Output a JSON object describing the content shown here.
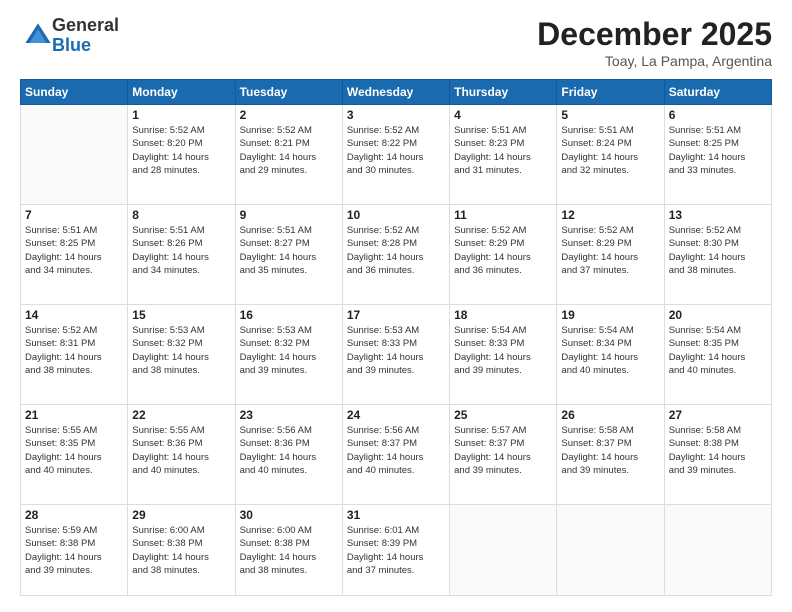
{
  "logo": {
    "general": "General",
    "blue": "Blue"
  },
  "header": {
    "title": "December 2025",
    "subtitle": "Toay, La Pampa, Argentina"
  },
  "weekdays": [
    "Sunday",
    "Monday",
    "Tuesday",
    "Wednesday",
    "Thursday",
    "Friday",
    "Saturday"
  ],
  "weeks": [
    [
      {
        "day": "",
        "info": ""
      },
      {
        "day": "1",
        "info": "Sunrise: 5:52 AM\nSunset: 8:20 PM\nDaylight: 14 hours\nand 28 minutes."
      },
      {
        "day": "2",
        "info": "Sunrise: 5:52 AM\nSunset: 8:21 PM\nDaylight: 14 hours\nand 29 minutes."
      },
      {
        "day": "3",
        "info": "Sunrise: 5:52 AM\nSunset: 8:22 PM\nDaylight: 14 hours\nand 30 minutes."
      },
      {
        "day": "4",
        "info": "Sunrise: 5:51 AM\nSunset: 8:23 PM\nDaylight: 14 hours\nand 31 minutes."
      },
      {
        "day": "5",
        "info": "Sunrise: 5:51 AM\nSunset: 8:24 PM\nDaylight: 14 hours\nand 32 minutes."
      },
      {
        "day": "6",
        "info": "Sunrise: 5:51 AM\nSunset: 8:25 PM\nDaylight: 14 hours\nand 33 minutes."
      }
    ],
    [
      {
        "day": "7",
        "info": "Sunrise: 5:51 AM\nSunset: 8:25 PM\nDaylight: 14 hours\nand 34 minutes."
      },
      {
        "day": "8",
        "info": "Sunrise: 5:51 AM\nSunset: 8:26 PM\nDaylight: 14 hours\nand 34 minutes."
      },
      {
        "day": "9",
        "info": "Sunrise: 5:51 AM\nSunset: 8:27 PM\nDaylight: 14 hours\nand 35 minutes."
      },
      {
        "day": "10",
        "info": "Sunrise: 5:52 AM\nSunset: 8:28 PM\nDaylight: 14 hours\nand 36 minutes."
      },
      {
        "day": "11",
        "info": "Sunrise: 5:52 AM\nSunset: 8:29 PM\nDaylight: 14 hours\nand 36 minutes."
      },
      {
        "day": "12",
        "info": "Sunrise: 5:52 AM\nSunset: 8:29 PM\nDaylight: 14 hours\nand 37 minutes."
      },
      {
        "day": "13",
        "info": "Sunrise: 5:52 AM\nSunset: 8:30 PM\nDaylight: 14 hours\nand 38 minutes."
      }
    ],
    [
      {
        "day": "14",
        "info": "Sunrise: 5:52 AM\nSunset: 8:31 PM\nDaylight: 14 hours\nand 38 minutes."
      },
      {
        "day": "15",
        "info": "Sunrise: 5:53 AM\nSunset: 8:32 PM\nDaylight: 14 hours\nand 38 minutes."
      },
      {
        "day": "16",
        "info": "Sunrise: 5:53 AM\nSunset: 8:32 PM\nDaylight: 14 hours\nand 39 minutes."
      },
      {
        "day": "17",
        "info": "Sunrise: 5:53 AM\nSunset: 8:33 PM\nDaylight: 14 hours\nand 39 minutes."
      },
      {
        "day": "18",
        "info": "Sunrise: 5:54 AM\nSunset: 8:33 PM\nDaylight: 14 hours\nand 39 minutes."
      },
      {
        "day": "19",
        "info": "Sunrise: 5:54 AM\nSunset: 8:34 PM\nDaylight: 14 hours\nand 40 minutes."
      },
      {
        "day": "20",
        "info": "Sunrise: 5:54 AM\nSunset: 8:35 PM\nDaylight: 14 hours\nand 40 minutes."
      }
    ],
    [
      {
        "day": "21",
        "info": "Sunrise: 5:55 AM\nSunset: 8:35 PM\nDaylight: 14 hours\nand 40 minutes."
      },
      {
        "day": "22",
        "info": "Sunrise: 5:55 AM\nSunset: 8:36 PM\nDaylight: 14 hours\nand 40 minutes."
      },
      {
        "day": "23",
        "info": "Sunrise: 5:56 AM\nSunset: 8:36 PM\nDaylight: 14 hours\nand 40 minutes."
      },
      {
        "day": "24",
        "info": "Sunrise: 5:56 AM\nSunset: 8:37 PM\nDaylight: 14 hours\nand 40 minutes."
      },
      {
        "day": "25",
        "info": "Sunrise: 5:57 AM\nSunset: 8:37 PM\nDaylight: 14 hours\nand 39 minutes."
      },
      {
        "day": "26",
        "info": "Sunrise: 5:58 AM\nSunset: 8:37 PM\nDaylight: 14 hours\nand 39 minutes."
      },
      {
        "day": "27",
        "info": "Sunrise: 5:58 AM\nSunset: 8:38 PM\nDaylight: 14 hours\nand 39 minutes."
      }
    ],
    [
      {
        "day": "28",
        "info": "Sunrise: 5:59 AM\nSunset: 8:38 PM\nDaylight: 14 hours\nand 39 minutes."
      },
      {
        "day": "29",
        "info": "Sunrise: 6:00 AM\nSunset: 8:38 PM\nDaylight: 14 hours\nand 38 minutes."
      },
      {
        "day": "30",
        "info": "Sunrise: 6:00 AM\nSunset: 8:38 PM\nDaylight: 14 hours\nand 38 minutes."
      },
      {
        "day": "31",
        "info": "Sunrise: 6:01 AM\nSunset: 8:39 PM\nDaylight: 14 hours\nand 37 minutes."
      },
      {
        "day": "",
        "info": ""
      },
      {
        "day": "",
        "info": ""
      },
      {
        "day": "",
        "info": ""
      }
    ]
  ]
}
